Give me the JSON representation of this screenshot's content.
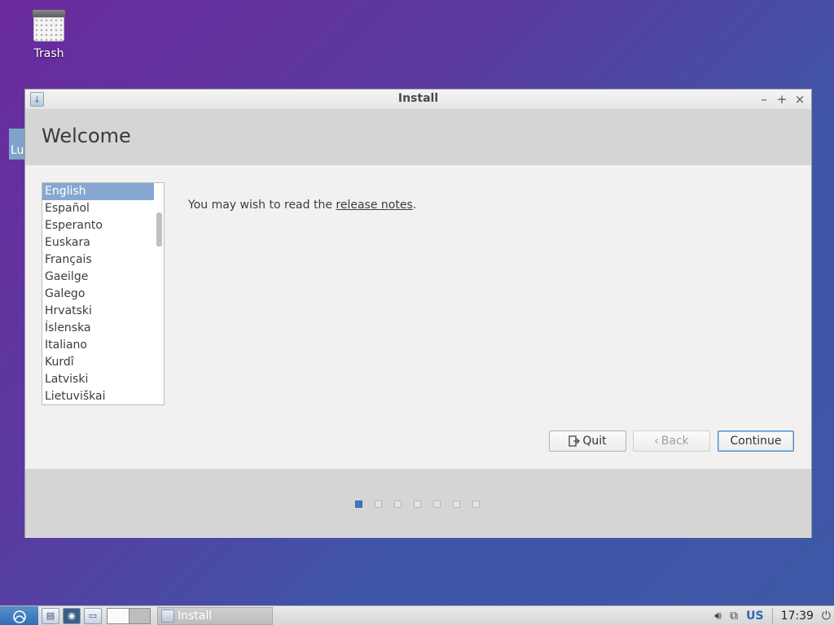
{
  "desktop": {
    "trash_label": "Trash",
    "side_tag": "Lu"
  },
  "window": {
    "title": "Install",
    "controls": [
      "–",
      "+",
      "×"
    ],
    "heading": "Welcome",
    "notes_text": "You may wish to read the ",
    "notes_link": "release notes",
    "notes_end": ".",
    "languages": [
      "English",
      "Español",
      "Esperanto",
      "Euskara",
      "Français",
      "Gaeilge",
      "Galego",
      "Hrvatski",
      "Íslenska",
      "Italiano",
      "Kurdî",
      "Latviski",
      "Lietuviškai"
    ],
    "selected_language": "English",
    "buttons": {
      "quit": "Quit",
      "back": "Back",
      "continue": "Continue"
    },
    "steps_total": 7,
    "step_current": 1
  },
  "taskbar": {
    "task_label": "Install",
    "keyboard_layout": "US",
    "clock": "17:39"
  },
  "icons": {
    "trash": "trash-icon",
    "installer": "installer-icon",
    "quit": "exit-icon",
    "back": "chevron-left-icon",
    "volume": "volume-icon",
    "network": "network-icon",
    "power": "power-icon"
  }
}
